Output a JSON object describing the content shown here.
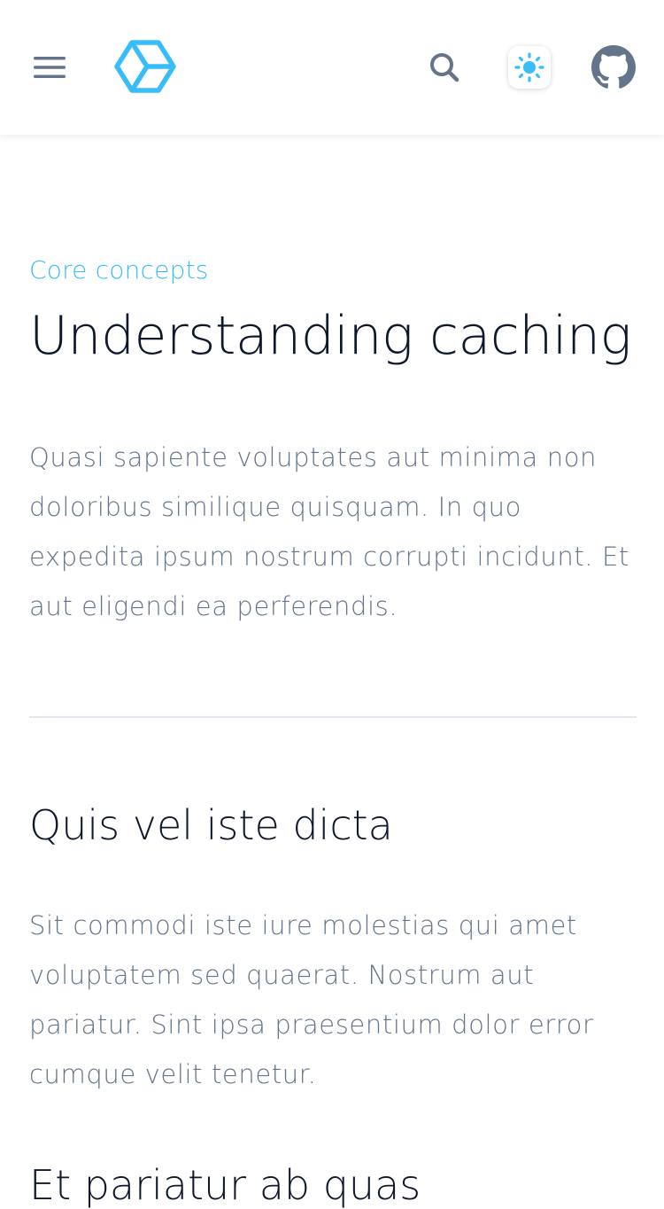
{
  "header": {
    "menu_icon": "hamburger-menu-icon",
    "logo_icon": "hexagon-logo-icon",
    "search_icon": "search-icon",
    "theme_icon": "sun-icon",
    "github_icon": "github-icon"
  },
  "colors": {
    "accent": "#38bdf8",
    "heading": "#0f172a",
    "body_text": "#64748b",
    "icon_gray": "#64748b",
    "divider": "#e2e8f0"
  },
  "article": {
    "eyebrow": "Core concepts",
    "title": "Understanding caching",
    "lead": "Quasi sapiente voluptates aut minima non doloribus similique quisquam. In quo expedita ipsum nostrum corrupti incidunt. Et aut eligendi ea perferendis.",
    "sections": [
      {
        "heading": "Quis vel iste dicta",
        "body": "Sit commodi iste iure molestias qui amet voluptatem sed quaerat. Nostrum aut pariatur. Sint ipsa praesentium dolor error cumque velit tenetur."
      },
      {
        "heading": "Et pariatur ab quas"
      }
    ]
  }
}
